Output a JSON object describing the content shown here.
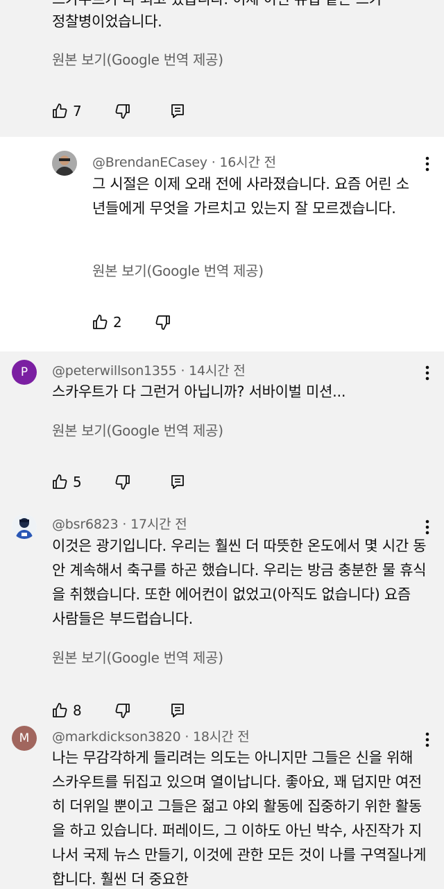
{
  "translate_label": "원본 보기(Google 번역 제공)",
  "colors": {
    "gray_bg": "#f2f2f2",
    "meta_text": "#606060",
    "avatar_p": "#7b1fa2",
    "avatar_m": "#a1665e"
  },
  "icons": {
    "like": "thumbs-up-icon",
    "dislike": "thumbs-down-icon",
    "reply": "reply-icon",
    "more": "more-vertical-icon"
  },
  "comment0": {
    "text_line1": "스카우트가 다 되고 있습니다. 이제 이런 유럽 같은 스카",
    "text_line2": "정찰병이었습니다.",
    "likes": "7"
  },
  "comment1": {
    "author": "@BrendanECasey",
    "time": "16시간 전",
    "text": "그 시절은 이제 오래 전에 사라졌습니다. 요즘 어린 소년들에게 무엇을 가르치고 있는지 잘 모르겠습니다.",
    "likes": "2"
  },
  "comment2": {
    "avatar_letter": "P",
    "author": "@peterwillson1355",
    "time": "14시간 전",
    "text": "스카우트가 다 그런거 아닙니까? 서바이벌 미션...",
    "likes": "5"
  },
  "comment3": {
    "author": "@bsr6823",
    "time": "17시간 전",
    "text": "이것은 광기입니다. 우리는 훨씬 더 따뜻한 온도에서 몇 시간 동안 계속해서 축구를 하곤 했습니다. 우리는 방금 충분한 물 휴식을 취했습니다. 또한 에어컨이 없었고(아직도 없습니다) 요즘 사람들은 부드럽습니다.",
    "likes": "8"
  },
  "comment4": {
    "avatar_letter": "M",
    "author": "@markdickson3820",
    "time": "18시간 전",
    "text": "나는 무감각하게 들리려는 의도는 아니지만 그들은 신을 위해 스카우트를 뒤집고 있으며 열이납니다. 좋아요, 꽤 덥지만 여전히 더위일 뿐이고 그들은 젊고 야외 활동에 집중하기 위한 활동을 하고 있습니다. 퍼레이드, 그 이하도 아닌 박수, 사진작가 지나서 국제 뉴스 만들기, 이것에 관한 모든 것이 나를 구역질나게 합니다. 훨씬 더 중요한"
  }
}
